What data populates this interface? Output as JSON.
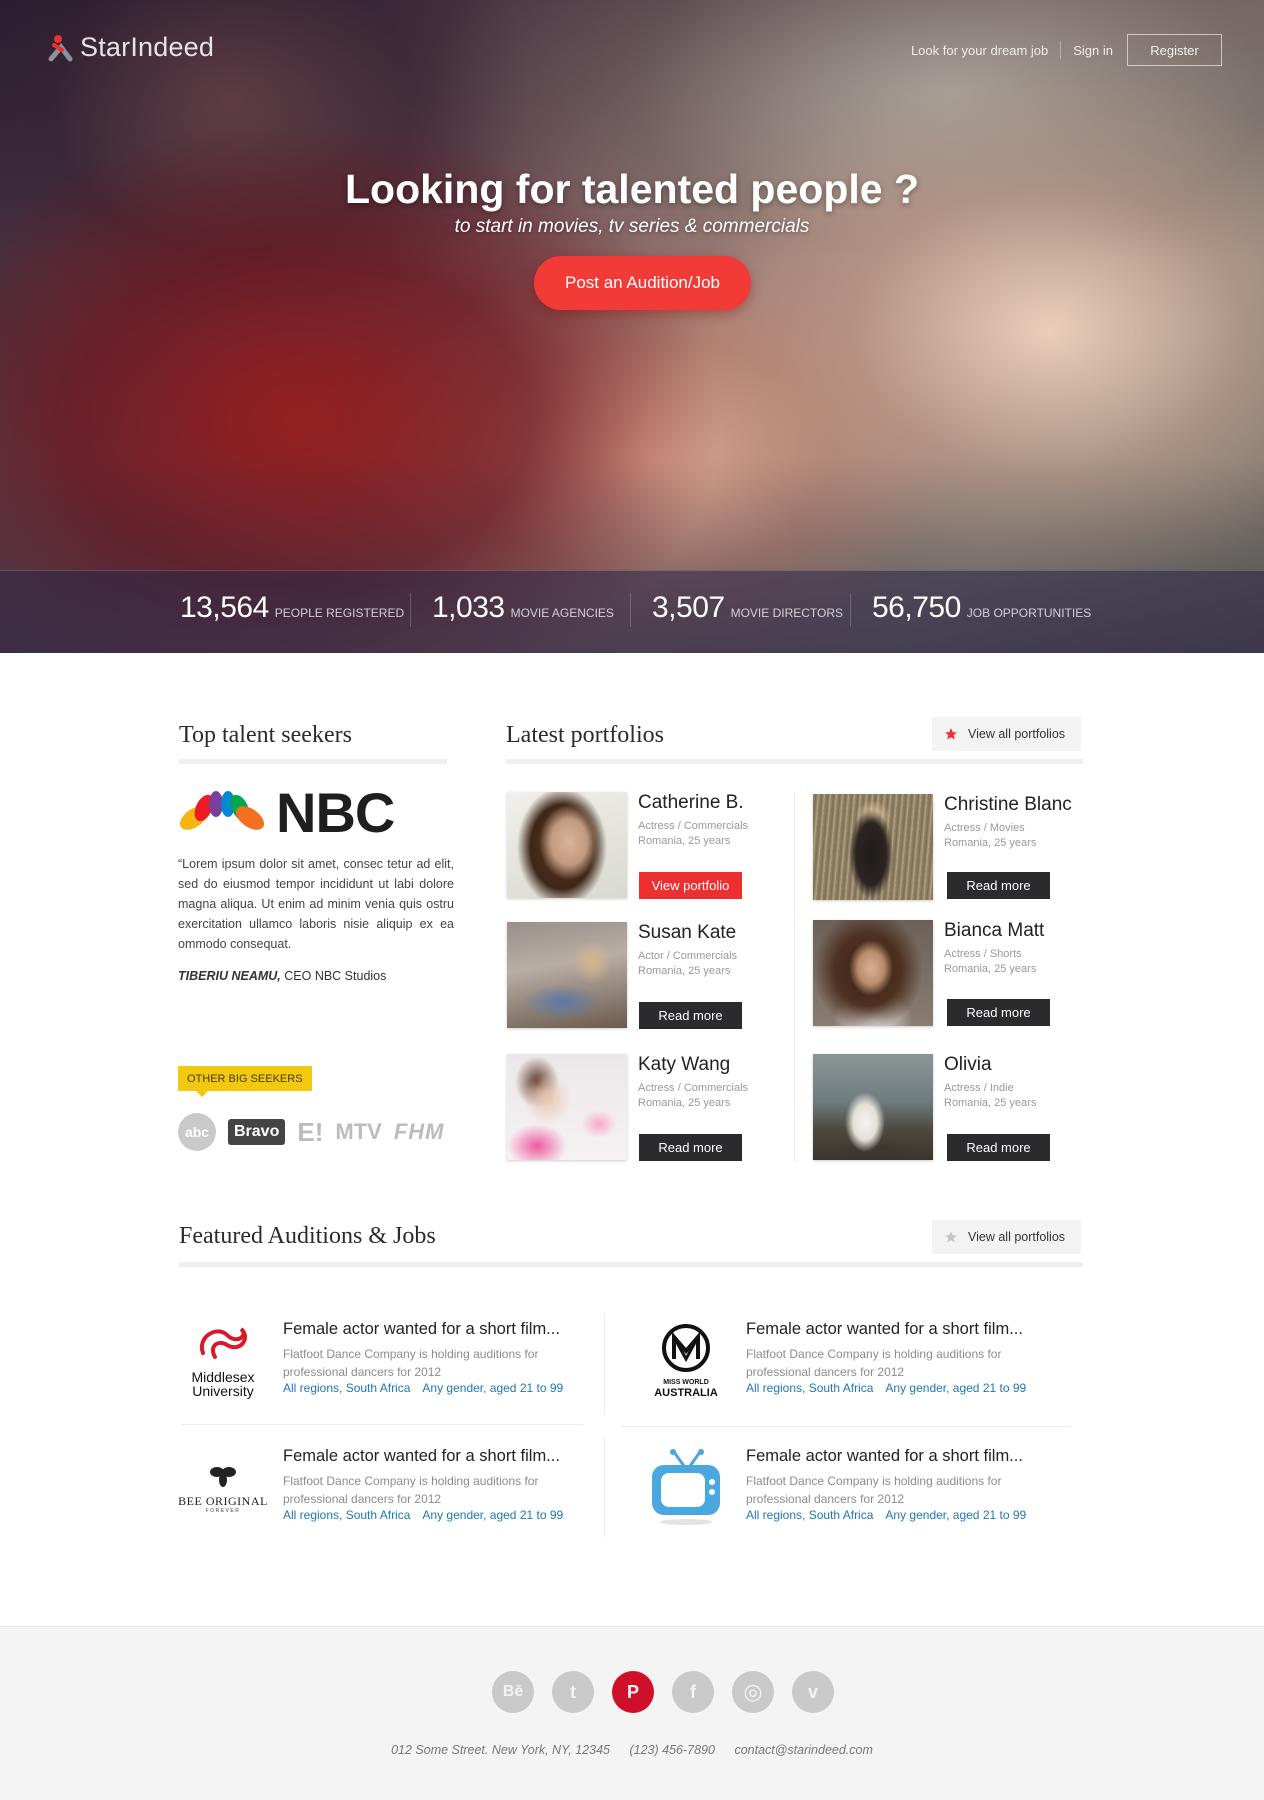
{
  "brand": {
    "name": "StarIndeed",
    "accent": "#f23a36"
  },
  "nav": {
    "dream_job": "Look for your dream job",
    "sign_in": "Sign in",
    "register": "Register"
  },
  "hero": {
    "title": "Looking for talented people ?",
    "subtitle": "to start in movies, tv series & commercials",
    "cta": "Post an Audition/Job"
  },
  "stats": [
    {
      "value": "13,564",
      "label": "PEOPLE REGISTERED"
    },
    {
      "value": "1,033",
      "label": "MOVIE AGENCIES"
    },
    {
      "value": "3,507",
      "label": "MOVIE DIRECTORS"
    },
    {
      "value": "56,750",
      "label": "JOB OPPORTUNITIES"
    }
  ],
  "talent_seekers": {
    "title": "Top talent seekers",
    "featured_logo": "NBC",
    "quote": "“Lorem ipsum dolor sit amet, consec tetur ad elit, sed do eiusmod tempor incididunt ut labi dolore magna aliqua. Ut enim ad minim venia quis ostru exercitation ullamco laboris nisie aliquip ex ea ommodo consequat.",
    "author_name": "TIBERIU NEAMU,",
    "author_role": " CEO NBC Studios",
    "other_tag": "OTHER BIG SEEKERS",
    "other_logos": [
      "abc",
      "Bravo",
      "E!",
      "MTV",
      "FHM"
    ]
  },
  "portfolios": {
    "title": "Latest portfolios",
    "view_all": "View all portfolios",
    "items": [
      {
        "name": "Catherine B.",
        "role": "Actress / Commercials",
        "location": "Romania, 25 years",
        "button": "View portfolio"
      },
      {
        "name": "Christine Blanc",
        "role": "Actress / Movies",
        "location": "Romania, 25 years",
        "button": "Read more"
      },
      {
        "name": "Susan Kate",
        "role": "Actor / Commercials",
        "location": "Romania, 25 years",
        "button": "Read more"
      },
      {
        "name": "Bianca Matt",
        "role": "Actress / Shorts",
        "location": "Romania, 25 years",
        "button": "Read more"
      },
      {
        "name": "Katy Wang",
        "role": "Actress / Commercials",
        "location": "Romania, 25 years",
        "button": "Read more"
      },
      {
        "name": "Olivia",
        "role": "Actress / Indie",
        "location": "Romania, 25 years",
        "button": "Read more"
      }
    ]
  },
  "jobs": {
    "title": "Featured Auditions & Jobs",
    "view_all": "View all portfolios",
    "items": [
      {
        "logo": "Middlesex University",
        "logo_line1": "Middlesex",
        "logo_line2": "University",
        "title": "Female actor wanted for a short film...",
        "desc": "Flatfoot Dance Company is holding auditions for professional dancers for 2012",
        "region": "All regions, South Africa",
        "gender": "Any gender, aged 21 to 99"
      },
      {
        "logo": "Miss World Australia",
        "logo_line1": "MISS WORLD",
        "logo_line2": "AUSTRALIA",
        "title": "Female actor wanted for a short film...",
        "desc": "Flatfoot Dance Company is holding auditions for professional dancers for 2012",
        "region": "All regions, South Africa",
        "gender": "Any gender, aged 21 to 99"
      },
      {
        "logo": "Bee Original",
        "logo_line1": "BEE ORIGINAL",
        "logo_line2": "FOREVER",
        "title": "Female actor wanted for a short film...",
        "desc": "Flatfoot Dance Company is holding auditions for professional dancers for 2012",
        "region": "All regions, South Africa",
        "gender": "Any gender, aged 21 to 99"
      },
      {
        "logo": "tv-icon",
        "title": "Female actor wanted for a short film...",
        "desc": "Flatfoot Dance Company is holding auditions for professional dancers for 2012",
        "region": "All regions, South Africa",
        "gender": "Any gender, aged 21 to 99"
      }
    ]
  },
  "footer": {
    "social": [
      {
        "name": "behance-icon",
        "glyph": "Bē"
      },
      {
        "name": "twitter-icon",
        "glyph": "t"
      },
      {
        "name": "pinterest-icon",
        "glyph": "P"
      },
      {
        "name": "facebook-icon",
        "glyph": "f"
      },
      {
        "name": "dribbble-icon",
        "glyph": "◎"
      },
      {
        "name": "vimeo-icon",
        "glyph": "v"
      }
    ],
    "address": "012 Some Street. New York, NY, 12345",
    "phone": "(123) 456-7890",
    "email": "contact@starindeed.com"
  }
}
